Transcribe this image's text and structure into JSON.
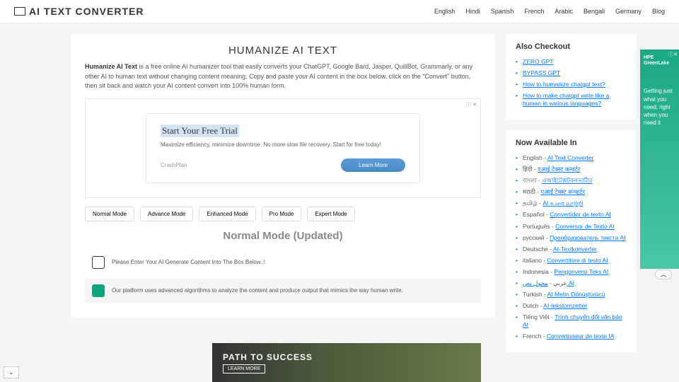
{
  "brand": "AI TEXT CONVERTER",
  "nav": [
    "English",
    "Hindi",
    "Spanish",
    "French",
    "Arabic",
    "Bengali",
    "Germany",
    "Blog"
  ],
  "title": "HUMANIZE AI TEXT",
  "desc_bold": "Humanize AI Text",
  "desc_rest": " is a free online AI humanizer tool that easily converts your ChatGPT, Google Bard, Jasper, QuillBot, Grammarly, or any other AI to human text without changing content meaning. Copy and paste your AI content in the box below, click on the \"Convert\" button, then sit back and watch your AI content convert into 100% human form.",
  "ad1": {
    "tag": "ⓘ ✕",
    "title": "Start Your Free Trial",
    "text": "Maximize efficiency, minimize downtime. No more slow file recovery. Start for free today!",
    "brand": "CrashPlan",
    "btn": "Learn More"
  },
  "modes": [
    "Normal Mode",
    "Advance Mode",
    "Enhanced Mode",
    "Pro Mode",
    "Expert Mode"
  ],
  "mode_title": "Normal Mode (Updated)",
  "msg_user": "Please Enter Your AI Generate Content Into The Box Below..!",
  "msg_ai": "Our platform uses advanced algorithms to analyze the content and produce output that mimics the way human write.",
  "checkout": {
    "title": "Also Checkout",
    "items": [
      "ZERO GPT",
      "BYPASS GPT",
      "How to humanize chatgpt text?",
      "How to make chatgpt write like a human in various languages?"
    ]
  },
  "langs": {
    "title": "Now Available In",
    "items": [
      {
        "p": "English - ",
        "l": "AI Text Converter"
      },
      {
        "p": "हिंदी - ",
        "l": "एआई टेक्स्ट कन्वर्टर"
      },
      {
        "p": "বাংলা - ",
        "l": "এআইটেক্সটকনভার্টার"
      },
      {
        "p": "मराठी - ",
        "l": "एआई टेक्स्ट कन्व्हर्टर"
      },
      {
        "p": "தமிழ் - ",
        "l": "AI உரை மாற்றி"
      },
      {
        "p": "Español - ",
        "l": "Convertidor de texto AI"
      },
      {
        "p": "Português - ",
        "l": "Conversor de Texto AI"
      },
      {
        "p": "русский - ",
        "l": "Преобразователь текста AI"
      },
      {
        "p": "Deutsche - ",
        "l": "AI-Textkonverter"
      },
      {
        "p": "italiano - ",
        "l": "Convertitore di testo AI"
      },
      {
        "p": "Indonesia - ",
        "l": "Pengonversi Teks AI"
      },
      {
        "p": "عربي - ",
        "l": "محول نص AI"
      },
      {
        "p": "Turkish - ",
        "l": "AI Metin Dönüştürücü"
      },
      {
        "p": "Dutch - ",
        "l": "AI-tekstomzetter"
      },
      {
        "p": "Tiếng Việt - ",
        "l": "Trình chuyển đổi văn bản AI"
      },
      {
        "p": "French - ",
        "l": "Convertisseur de texte IA"
      }
    ]
  },
  "rad": {
    "brand1": "HPE",
    "brand2": "GreenLake",
    "text": "Getting just what you need, right when you need it"
  },
  "bad": {
    "title": "PATH TO SUCCESS",
    "btn": "LEARN MORE"
  }
}
